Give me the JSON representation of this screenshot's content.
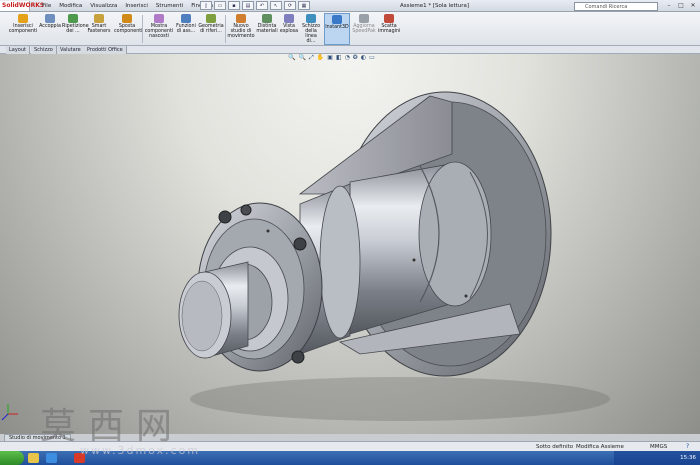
{
  "app": {
    "logo_text": "SolidWORKS",
    "document_title": "Assieme1 * [Sola lettura]"
  },
  "menu": [
    "File",
    "Modifica",
    "Visualizza",
    "Inserisci",
    "Strumenti",
    "Finestra"
  ],
  "search": {
    "placeholder": "Comandi Ricerca"
  },
  "ribbon": [
    {
      "label": "Inserisci componenti",
      "color": "#e3a21a"
    },
    {
      "label": "Accoppia",
      "color": "#6f8fbf"
    },
    {
      "label": "Ripetizione dei ...",
      "color": "#4d9a4d"
    },
    {
      "label": "Smart Fasteners",
      "color": "#c8a23c"
    },
    {
      "label": "Sposta componenti",
      "color": "#d08a1a"
    },
    {
      "label": "Mostra componenti nascosti",
      "color": "#b07ac8"
    },
    {
      "label": "Funzioni di ass...",
      "color": "#4f7fbf"
    },
    {
      "label": "Geometria di riferi...",
      "color": "#7f9f3f"
    },
    {
      "label": "Nuovo studio di movimento",
      "color": "#cf7f2f"
    },
    {
      "label": "Distinta materiali",
      "color": "#5f8f5f"
    },
    {
      "label": "Vista esplosa",
      "color": "#7f7fbf"
    },
    {
      "label": "Schizzo della linea di...",
      "color": "#3f8fbf"
    },
    {
      "label": "Instant3D",
      "color": "#3a78c8"
    },
    {
      "label": "Aggiorna SpeedPak",
      "color": "#9aa0a8"
    },
    {
      "label": "Scatta immagini",
      "color": "#c24a3a"
    }
  ],
  "tabs": [
    "Layout",
    "Schizzo",
    "Valutare",
    "Prodotti Office"
  ],
  "view_icons": [
    "🔍",
    "🔍",
    "⤢",
    "✋",
    "▣",
    "◧",
    "◔",
    "❂",
    "◐",
    "▭"
  ],
  "motion_tab": "Studio di movimento 1",
  "status": {
    "state": "Sotto definito",
    "mode": "Modifica Assieme",
    "units": "MMGS",
    "help": "?"
  },
  "clock": "15:36",
  "watermark": {
    "chars": "莫西网",
    "site": "www.3dmox.com"
  },
  "colors": {
    "accent": "#3a78c8",
    "logo": "#c41e1e",
    "taskbar": "#1f4f9a"
  }
}
